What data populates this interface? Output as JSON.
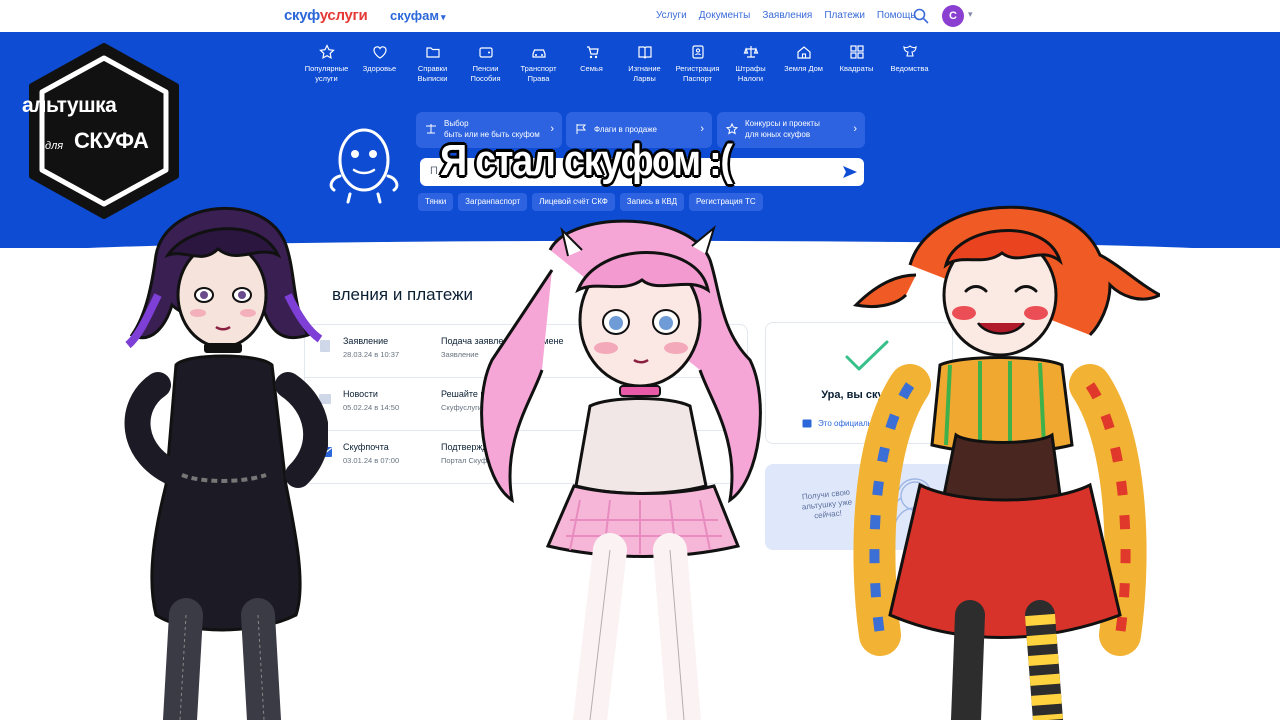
{
  "header": {
    "logo_part1": "скуф",
    "logo_part2": "услуги",
    "region": "скуфам",
    "nav": [
      "Услуги",
      "Документы",
      "Заявления",
      "Платежи",
      "Помощь"
    ],
    "avatar_letter": "С"
  },
  "categories": [
    {
      "label": "Популярные услуги",
      "icon": "star-icon"
    },
    {
      "label": "Здоровье",
      "icon": "health-icon"
    },
    {
      "label": "Справки Выписки",
      "icon": "folder-icon"
    },
    {
      "label": "Пенсии Пособия",
      "icon": "wallet-icon"
    },
    {
      "label": "Транспорт Права",
      "icon": "car-icon"
    },
    {
      "label": "Семья",
      "icon": "stroller-icon"
    },
    {
      "label": "Изгнание Ларвы",
      "icon": "book-icon"
    },
    {
      "label": "Регистрация Паспорт",
      "icon": "id-card-icon"
    },
    {
      "label": "Штрафы Налоги",
      "icon": "scales-icon"
    },
    {
      "label": "Земля Дом",
      "icon": "house-icon"
    },
    {
      "label": "Квадраты",
      "icon": "squares-icon"
    },
    {
      "label": "Ведомства",
      "icon": "emblem-icon"
    }
  ],
  "promos": [
    {
      "line1": "Выбор",
      "line2": "быть или не быть скуфом"
    },
    {
      "line1": "Флаги в продаже",
      "line2": ""
    },
    {
      "line1": "Конкурсы и проекты",
      "line2": "для юных скуфов"
    }
  ],
  "search": {
    "placeholder": "П"
  },
  "chips": [
    "Тянки",
    "Загранпаспорт",
    "Лицевой счёт СКФ",
    "Запись в КВД",
    "Регистрация ТС"
  ],
  "section": {
    "title": "вления и платежи"
  },
  "rows": [
    {
      "title": "Заявление",
      "date": "28.03.24 в 10:37",
      "subject": "Подача заявления на измене",
      "source": "Заявление"
    },
    {
      "title": "Новости",
      "date": "05.02.24 в 14:50",
      "subject": "Решайте вопросы",
      "source": "Скуфуслуги"
    },
    {
      "title": "Скуфпочта",
      "date": "03.01.24 в 07:00",
      "subject": "Подтверждение",
      "source": "Портал Скуф"
    }
  ],
  "status": {
    "title": "Ура, вы скуф!",
    "link": "Это официально"
  },
  "promo_card": {
    "text": "Получи свою альтушку уже сейчас!"
  },
  "overlay": {
    "title": "Я стал скуфом :("
  },
  "badge": {
    "line1": "альтушка",
    "line2": "для",
    "line3": "СКУФА"
  },
  "colors": {
    "brand_blue": "#0d4cd3",
    "accent_red": "#e53935",
    "card_border": "#e3e8ee"
  }
}
